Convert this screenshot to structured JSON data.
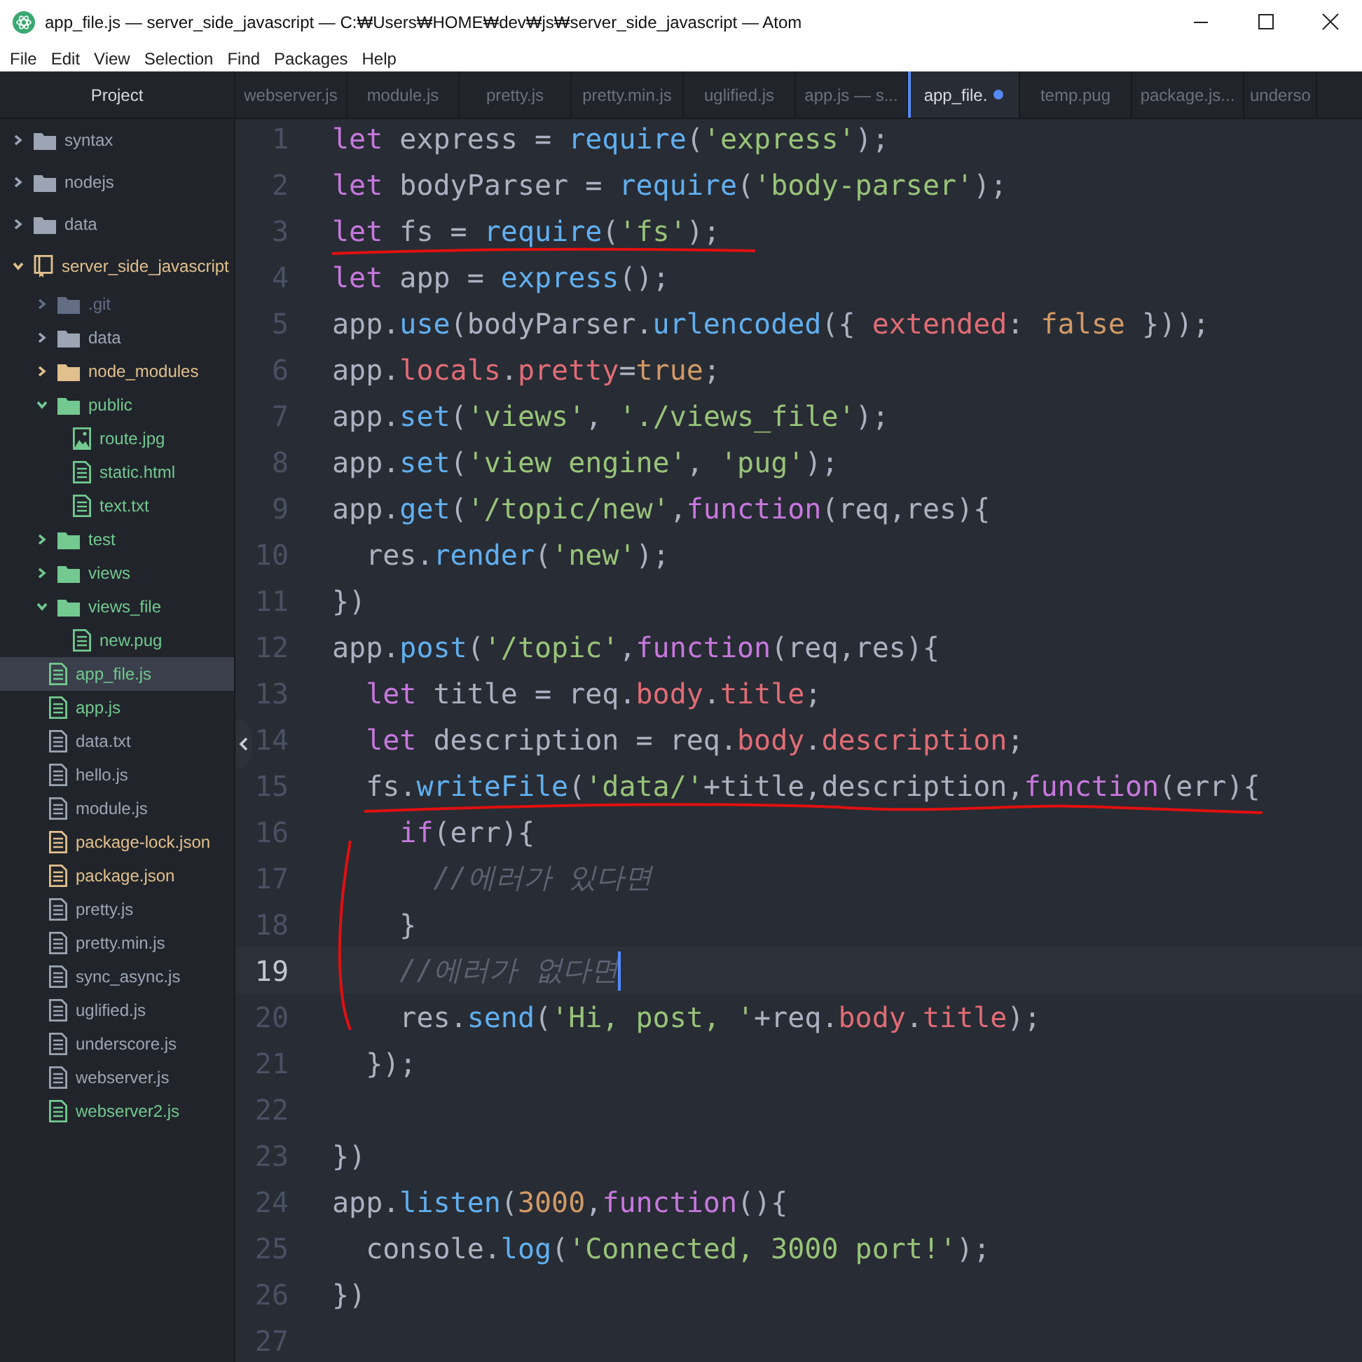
{
  "window": {
    "title": "app_file.js — server_side_javascript — C:₩Users₩HOME₩dev₩js₩server_side_javascript — Atom"
  },
  "menu": [
    "File",
    "Edit",
    "View",
    "Selection",
    "Find",
    "Packages",
    "Help"
  ],
  "sidebar": {
    "title": "Project",
    "items": [
      {
        "name": "syntax",
        "kind": "folder",
        "color": "#9da5b4",
        "expanded": false,
        "selected": false
      },
      {
        "name": "nodejs",
        "kind": "folder",
        "color": "#9da5b4",
        "expanded": false,
        "selected": false
      },
      {
        "name": "data",
        "kind": "folder",
        "color": "#9da5b4",
        "expanded": false,
        "selected": false
      },
      {
        "name": "server_side_javascript",
        "kind": "repo",
        "color": "#e2c08d",
        "expanded": true,
        "selected": false,
        "children": [
          {
            "name": ".git",
            "kind": "folder",
            "color": "#636d83",
            "expanded": false,
            "selected": false
          },
          {
            "name": "data",
            "kind": "folder",
            "color": "#9da5b4",
            "expanded": false,
            "selected": false
          },
          {
            "name": "node_modules",
            "kind": "folder",
            "color": "#e2c08d",
            "expanded": false,
            "selected": false
          },
          {
            "name": "public",
            "kind": "folder",
            "color": "#73c990",
            "expanded": true,
            "selected": false,
            "children": [
              {
                "name": "route.jpg",
                "kind": "image",
                "color": "#73c990",
                "selected": false
              },
              {
                "name": "static.html",
                "kind": "file",
                "color": "#73c990",
                "selected": false
              },
              {
                "name": "text.txt",
                "kind": "file",
                "color": "#73c990",
                "selected": false
              }
            ]
          },
          {
            "name": "test",
            "kind": "folder",
            "color": "#73c990",
            "expanded": false,
            "selected": false
          },
          {
            "name": "views",
            "kind": "folder",
            "color": "#73c990",
            "expanded": false,
            "selected": false
          },
          {
            "name": "views_file",
            "kind": "folder",
            "color": "#73c990",
            "expanded": true,
            "selected": false,
            "children": [
              {
                "name": "new.pug",
                "kind": "file",
                "color": "#73c990",
                "selected": false
              }
            ]
          },
          {
            "name": "app_file.js",
            "kind": "file",
            "color": "#73c990",
            "selected": true
          },
          {
            "name": "app.js",
            "kind": "file",
            "color": "#73c990",
            "selected": false
          },
          {
            "name": "data.txt",
            "kind": "file",
            "color": "#9da5b4",
            "selected": false
          },
          {
            "name": "hello.js",
            "kind": "file",
            "color": "#9da5b4",
            "selected": false
          },
          {
            "name": "module.js",
            "kind": "file",
            "color": "#9da5b4",
            "selected": false
          },
          {
            "name": "package-lock.json",
            "kind": "file",
            "color": "#e2c08d",
            "selected": false
          },
          {
            "name": "package.json",
            "kind": "file",
            "color": "#e2c08d",
            "selected": false
          },
          {
            "name": "pretty.js",
            "kind": "file",
            "color": "#9da5b4",
            "selected": false
          },
          {
            "name": "pretty.min.js",
            "kind": "file",
            "color": "#9da5b4",
            "selected": false
          },
          {
            "name": "sync_async.js",
            "kind": "file",
            "color": "#9da5b4",
            "selected": false
          },
          {
            "name": "uglified.js",
            "kind": "file",
            "color": "#9da5b4",
            "selected": false
          },
          {
            "name": "underscore.js",
            "kind": "file",
            "color": "#9da5b4",
            "selected": false
          },
          {
            "name": "webserver.js",
            "kind": "file",
            "color": "#9da5b4",
            "selected": false
          },
          {
            "name": "webserver2.js",
            "kind": "file",
            "color": "#73c990",
            "selected": false
          }
        ]
      }
    ]
  },
  "tabs": [
    {
      "label": "webserver.js",
      "selected": false,
      "modified": false
    },
    {
      "label": "module.js",
      "selected": false,
      "modified": false
    },
    {
      "label": "pretty.js",
      "selected": false,
      "modified": false
    },
    {
      "label": "pretty.min.js",
      "selected": false,
      "modified": false
    },
    {
      "label": "uglified.js",
      "selected": false,
      "modified": false
    },
    {
      "label": "app.js — s...",
      "selected": false,
      "modified": false
    },
    {
      "label": "app_file.",
      "selected": true,
      "modified": true
    },
    {
      "label": "temp.pug",
      "selected": false,
      "modified": false
    },
    {
      "label": "package.js...",
      "selected": false,
      "modified": false
    },
    {
      "label": "underso",
      "selected": false,
      "modified": false
    }
  ],
  "editor": {
    "lines": [
      {
        "number": "1",
        "cursor": false,
        "tokens": [
          {
            "kind": "keyword",
            "text": "let"
          },
          {
            "kind": "plain",
            "text": " express = "
          },
          {
            "kind": "function",
            "text": "require"
          },
          {
            "kind": "plain",
            "text": "("
          },
          {
            "kind": "string",
            "text": "'express'"
          },
          {
            "kind": "plain",
            "text": ");"
          }
        ]
      },
      {
        "number": "2",
        "cursor": false,
        "tokens": [
          {
            "kind": "keyword",
            "text": "let"
          },
          {
            "kind": "plain",
            "text": " bodyParser = "
          },
          {
            "kind": "function",
            "text": "require"
          },
          {
            "kind": "plain",
            "text": "("
          },
          {
            "kind": "string",
            "text": "'body-parser'"
          },
          {
            "kind": "plain",
            "text": ");"
          }
        ]
      },
      {
        "number": "3",
        "cursor": false,
        "tokens": [
          {
            "kind": "keyword",
            "text": "let"
          },
          {
            "kind": "plain",
            "text": " fs = "
          },
          {
            "kind": "function",
            "text": "require"
          },
          {
            "kind": "plain",
            "text": "("
          },
          {
            "kind": "string",
            "text": "'fs'"
          },
          {
            "kind": "plain",
            "text": ");"
          }
        ]
      },
      {
        "number": "4",
        "cursor": false,
        "tokens": [
          {
            "kind": "keyword",
            "text": "let"
          },
          {
            "kind": "plain",
            "text": " app = "
          },
          {
            "kind": "function",
            "text": "express"
          },
          {
            "kind": "plain",
            "text": "();"
          }
        ]
      },
      {
        "number": "5",
        "cursor": false,
        "tokens": [
          {
            "kind": "plain",
            "text": "app."
          },
          {
            "kind": "function",
            "text": "use"
          },
          {
            "kind": "plain",
            "text": "(bodyParser."
          },
          {
            "kind": "function",
            "text": "urlencoded"
          },
          {
            "kind": "plain",
            "text": "({ "
          },
          {
            "kind": "property",
            "text": "extended"
          },
          {
            "kind": "plain",
            "text": ": "
          },
          {
            "kind": "number",
            "text": "false"
          },
          {
            "kind": "plain",
            "text": " }));"
          }
        ]
      },
      {
        "number": "6",
        "cursor": false,
        "tokens": [
          {
            "kind": "plain",
            "text": "app."
          },
          {
            "kind": "property",
            "text": "locals"
          },
          {
            "kind": "plain",
            "text": "."
          },
          {
            "kind": "property",
            "text": "pretty"
          },
          {
            "kind": "plain",
            "text": "="
          },
          {
            "kind": "number",
            "text": "true"
          },
          {
            "kind": "plain",
            "text": ";"
          }
        ]
      },
      {
        "number": "7",
        "cursor": false,
        "tokens": [
          {
            "kind": "plain",
            "text": "app."
          },
          {
            "kind": "function",
            "text": "set"
          },
          {
            "kind": "plain",
            "text": "("
          },
          {
            "kind": "string",
            "text": "'views'"
          },
          {
            "kind": "plain",
            "text": ", "
          },
          {
            "kind": "string",
            "text": "'./views_file'"
          },
          {
            "kind": "plain",
            "text": ");"
          }
        ]
      },
      {
        "number": "8",
        "cursor": false,
        "tokens": [
          {
            "kind": "plain",
            "text": "app."
          },
          {
            "kind": "function",
            "text": "set"
          },
          {
            "kind": "plain",
            "text": "("
          },
          {
            "kind": "string",
            "text": "'view engine'"
          },
          {
            "kind": "plain",
            "text": ", "
          },
          {
            "kind": "string",
            "text": "'pug'"
          },
          {
            "kind": "plain",
            "text": ");"
          }
        ]
      },
      {
        "number": "9",
        "cursor": false,
        "tokens": [
          {
            "kind": "plain",
            "text": "app."
          },
          {
            "kind": "function",
            "text": "get"
          },
          {
            "kind": "plain",
            "text": "("
          },
          {
            "kind": "string",
            "text": "'/topic/new'"
          },
          {
            "kind": "plain",
            "text": ","
          },
          {
            "kind": "keyword",
            "text": "function"
          },
          {
            "kind": "plain",
            "text": "(req,res){"
          }
        ]
      },
      {
        "number": "10",
        "cursor": false,
        "tokens": [
          {
            "kind": "plain",
            "text": "  res."
          },
          {
            "kind": "function",
            "text": "render"
          },
          {
            "kind": "plain",
            "text": "("
          },
          {
            "kind": "string",
            "text": "'new'"
          },
          {
            "kind": "plain",
            "text": ");"
          }
        ]
      },
      {
        "number": "11",
        "cursor": false,
        "tokens": [
          {
            "kind": "plain",
            "text": "})"
          }
        ]
      },
      {
        "number": "12",
        "cursor": false,
        "tokens": [
          {
            "kind": "plain",
            "text": "app."
          },
          {
            "kind": "function",
            "text": "post"
          },
          {
            "kind": "plain",
            "text": "("
          },
          {
            "kind": "string",
            "text": "'/topic'"
          },
          {
            "kind": "plain",
            "text": ","
          },
          {
            "kind": "keyword",
            "text": "function"
          },
          {
            "kind": "plain",
            "text": "(req,res){"
          }
        ]
      },
      {
        "number": "13",
        "cursor": false,
        "tokens": [
          {
            "kind": "keyword",
            "text": "  let"
          },
          {
            "kind": "plain",
            "text": " title = req."
          },
          {
            "kind": "property",
            "text": "body"
          },
          {
            "kind": "plain",
            "text": "."
          },
          {
            "kind": "property",
            "text": "title"
          },
          {
            "kind": "plain",
            "text": ";"
          }
        ]
      },
      {
        "number": "14",
        "cursor": false,
        "tokens": [
          {
            "kind": "keyword",
            "text": "  let"
          },
          {
            "kind": "plain",
            "text": " description = req."
          },
          {
            "kind": "property",
            "text": "body"
          },
          {
            "kind": "plain",
            "text": "."
          },
          {
            "kind": "property",
            "text": "description"
          },
          {
            "kind": "plain",
            "text": ";"
          }
        ]
      },
      {
        "number": "15",
        "cursor": false,
        "tokens": [
          {
            "kind": "plain",
            "text": "  fs."
          },
          {
            "kind": "function",
            "text": "writeFile"
          },
          {
            "kind": "plain",
            "text": "("
          },
          {
            "kind": "string",
            "text": "'data/'"
          },
          {
            "kind": "plain",
            "text": "+title,description,"
          },
          {
            "kind": "keyword",
            "text": "function"
          },
          {
            "kind": "plain",
            "text": "(err){"
          }
        ]
      },
      {
        "number": "16",
        "cursor": false,
        "tokens": [
          {
            "kind": "keyword",
            "text": "    if"
          },
          {
            "kind": "plain",
            "text": "(err){"
          }
        ]
      },
      {
        "number": "17",
        "cursor": false,
        "tokens": [
          {
            "kind": "comment",
            "text": "      //에러가 있다면"
          }
        ]
      },
      {
        "number": "18",
        "cursor": false,
        "tokens": [
          {
            "kind": "plain",
            "text": "    }"
          }
        ]
      },
      {
        "number": "19",
        "cursor": true,
        "tokens": [
          {
            "kind": "comment",
            "text": "    //에러가 없다면"
          }
        ]
      },
      {
        "number": "20",
        "cursor": false,
        "tokens": [
          {
            "kind": "plain",
            "text": "    res."
          },
          {
            "kind": "function",
            "text": "send"
          },
          {
            "kind": "plain",
            "text": "("
          },
          {
            "kind": "string",
            "text": "'Hi, post, '"
          },
          {
            "kind": "plain",
            "text": "+req."
          },
          {
            "kind": "property",
            "text": "body"
          },
          {
            "kind": "plain",
            "text": "."
          },
          {
            "kind": "property",
            "text": "title"
          },
          {
            "kind": "plain",
            "text": ");"
          }
        ]
      },
      {
        "number": "21",
        "cursor": false,
        "tokens": [
          {
            "kind": "plain",
            "text": "  });"
          }
        ]
      },
      {
        "number": "22",
        "cursor": false
      },
      {
        "number": "23",
        "cursor": false,
        "tokens": [
          {
            "kind": "plain",
            "text": "})"
          }
        ]
      },
      {
        "number": "24",
        "cursor": false,
        "tokens": [
          {
            "kind": "plain",
            "text": "app."
          },
          {
            "kind": "function",
            "text": "listen"
          },
          {
            "kind": "plain",
            "text": "("
          },
          {
            "kind": "number",
            "text": "3000"
          },
          {
            "kind": "plain",
            "text": ","
          },
          {
            "kind": "keyword",
            "text": "function"
          },
          {
            "kind": "plain",
            "text": "(){"
          }
        ]
      },
      {
        "number": "25",
        "cursor": false,
        "tokens": [
          {
            "kind": "plain",
            "text": "  console."
          },
          {
            "kind": "function",
            "text": "log"
          },
          {
            "kind": "plain",
            "text": "("
          },
          {
            "kind": "string",
            "text": "'Connected, 3000 port!'"
          },
          {
            "kind": "plain",
            "text": ");"
          }
        ]
      },
      {
        "number": "26",
        "cursor": false,
        "tokens": [
          {
            "kind": "plain",
            "text": "})"
          }
        ]
      },
      {
        "number": "27",
        "cursor": false
      }
    ]
  }
}
